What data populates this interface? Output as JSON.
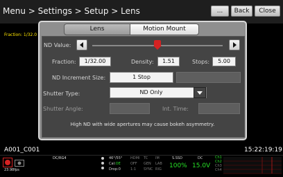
{
  "header": {
    "breadcrumb": "Menu > Settings > Setup > Lens",
    "buttons": {
      "more": "...",
      "back": "Back",
      "close": "Close"
    }
  },
  "side_readout": "Fraction: 1/32.0",
  "tabs": [
    {
      "label": "Lens",
      "selected": false
    },
    {
      "label": "Motion Mount",
      "selected": true
    }
  ],
  "nd": {
    "value_label": "ND Value:",
    "slider_position_fraction": 0.5,
    "fraction_label": "Fraction:",
    "fraction_value": "1/32.00",
    "density_label": "Density:",
    "density_value": "1.51",
    "stops_label": "Stops:",
    "stops_value": "5.00",
    "increment_label": "ND Increment Size:",
    "increment_value": "1 Stop"
  },
  "shutter": {
    "type_label": "Shutter Type:",
    "type_value": "ND Only",
    "angle_label": "Shutter Angle:",
    "int_time_label": "Int. Time:"
  },
  "warning_text": "High ND with wide apertures may cause bokeh asymmetry.",
  "clip_name": "A001_C001",
  "timecode": "15:22:19:19",
  "status": {
    "fps": "23.98fps",
    "format": "DC/RG4",
    "shutter_angle": "46°/55°",
    "cal_label": "Cal:",
    "cal_value": "OE",
    "drop_label": "Drop:",
    "drop_value": "0",
    "grid": [
      [
        "HDMI",
        "TC",
        "IM"
      ],
      [
        "OFF",
        "GEN",
        "LAB"
      ],
      [
        "1:1",
        "SYNC",
        "RIG"
      ]
    ],
    "media_label": "S.SSD",
    "media_value": "100%",
    "power_label": "DC",
    "power_value": "15.0V",
    "channels": [
      "Ch1",
      "Ch2",
      "Ch3",
      "Ch4"
    ]
  },
  "colors": {
    "accent_red": "#d62222",
    "status_green": "#27e227",
    "side_yellow": "#ffe600"
  }
}
